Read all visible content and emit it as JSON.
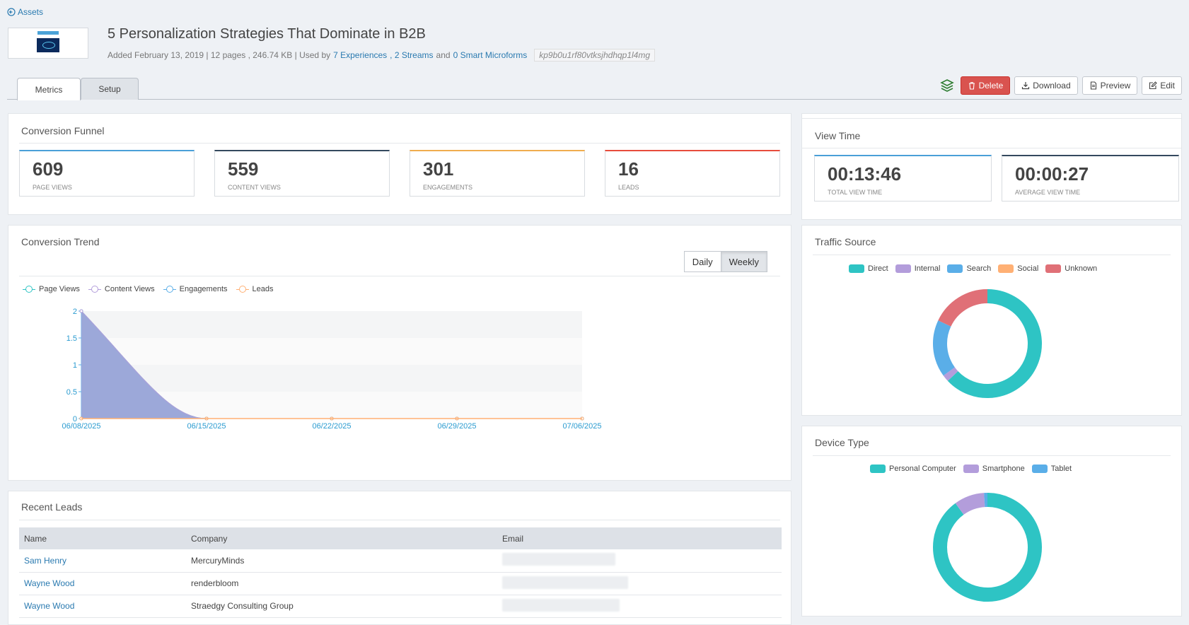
{
  "header": {
    "back_label": "Assets",
    "title": "5 Personalization Strategies That Dominate in B2B",
    "meta_prefix": "Added February 13, 2019 | 12 pages , 246.74 KB | Used by",
    "experiences_link": "7 Experiences",
    "streams_link": ", 2 Streams",
    "and_text": "and",
    "microforms_link": "0 Smart Microforms",
    "hash": "kp9b0u1rf80vtksjhdhqp1l4mg"
  },
  "tabs": [
    {
      "label": "Metrics",
      "active": true
    },
    {
      "label": "Setup",
      "active": false
    }
  ],
  "actions": {
    "delete_label": "Delete",
    "download_label": "Download",
    "preview_label": "Preview",
    "edit_label": "Edit"
  },
  "funnel": {
    "title": "Conversion Funnel",
    "stats": [
      {
        "value": "609",
        "label": "Page Views",
        "color": "#4a9fd8"
      },
      {
        "value": "559",
        "label": "Content Views",
        "color": "#34495e"
      },
      {
        "value": "301",
        "label": "Engagements",
        "color": "#f0ad4e"
      },
      {
        "value": "16",
        "label": "Leads",
        "color": "#e74c3c"
      }
    ]
  },
  "view_time": {
    "title": "View Time",
    "stats": [
      {
        "value": "00:13:46",
        "label": "Total View Time",
        "color": "#4a9fd8"
      },
      {
        "value": "00:00:27",
        "label": "Average View Time",
        "color": "#34495e"
      }
    ]
  },
  "trend": {
    "title": "Conversion Trend",
    "daily_label": "Daily",
    "weekly_label": "Weekly",
    "legend": [
      {
        "name": "Page Views",
        "color": "#2ec4c4"
      },
      {
        "name": "Content Views",
        "color": "#b39ddb"
      },
      {
        "name": "Engagements",
        "color": "#5aaee8"
      },
      {
        "name": "Leads",
        "color": "#ffb074"
      }
    ]
  },
  "traffic": {
    "title": "Traffic Source",
    "legend": [
      {
        "name": "Direct",
        "color": "#2ec4c4"
      },
      {
        "name": "Internal",
        "color": "#b39ddb"
      },
      {
        "name": "Search",
        "color": "#5aaee8"
      },
      {
        "name": "Social",
        "color": "#ffb074"
      },
      {
        "name": "Unknown",
        "color": "#e07077"
      }
    ]
  },
  "device": {
    "title": "Device Type",
    "legend": [
      {
        "name": "Personal Computer",
        "color": "#2ec4c4"
      },
      {
        "name": "Smartphone",
        "color": "#b39ddb"
      },
      {
        "name": "Tablet",
        "color": "#5aaee8"
      }
    ]
  },
  "leads": {
    "title": "Recent Leads",
    "columns": [
      "Name",
      "Company",
      "Email"
    ],
    "rows": [
      {
        "name": "Sam Henry",
        "company": "MercuryMinds"
      },
      {
        "name": "Wayne Wood",
        "company": "renderbloom"
      },
      {
        "name": "Wayne Wood",
        "company": "Straedgy Consulting Group"
      }
    ]
  },
  "chart_data": [
    {
      "type": "area",
      "x": [
        "06/08/2025",
        "06/15/2025",
        "06/22/2025",
        "06/29/2025",
        "07/06/2025"
      ],
      "ylim": [
        0,
        2
      ],
      "yticks": [
        "0",
        "0.5",
        "1",
        "1.5",
        "2"
      ],
      "series": [
        {
          "name": "Page Views",
          "values": [
            2,
            0,
            0,
            0,
            0
          ]
        },
        {
          "name": "Content Views",
          "values": [
            2,
            0,
            0,
            0,
            0
          ]
        },
        {
          "name": "Engagements",
          "values": [
            0,
            0,
            0,
            0,
            0
          ]
        },
        {
          "name": "Leads",
          "values": [
            0,
            0,
            0,
            0,
            0
          ]
        }
      ]
    },
    {
      "type": "pie",
      "donut": true,
      "categories": [
        "Direct",
        "Internal",
        "Search",
        "Social",
        "Unknown"
      ],
      "values": [
        63,
        2,
        17,
        0,
        18
      ]
    },
    {
      "type": "pie",
      "donut": true,
      "categories": [
        "Personal Computer",
        "Smartphone",
        "Tablet"
      ],
      "values": [
        90,
        9,
        1
      ]
    }
  ]
}
